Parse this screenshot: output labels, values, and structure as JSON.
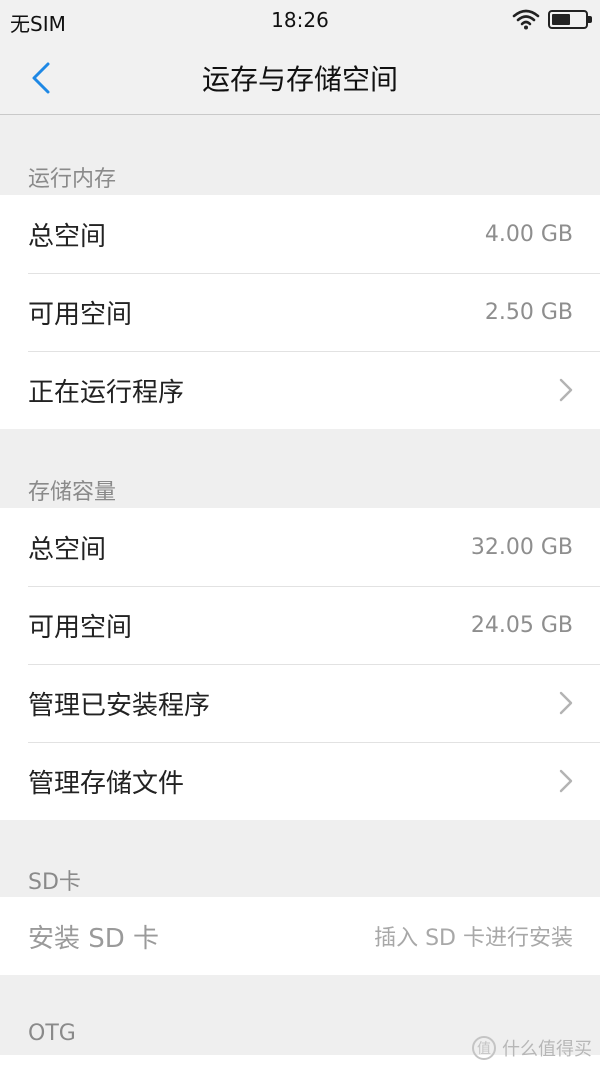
{
  "status_bar": {
    "carrier": "无SIM",
    "time": "18:26",
    "battery_level": 0.55
  },
  "nav": {
    "title": "运存与存储空间"
  },
  "sections": {
    "ram": {
      "header": "运行内存",
      "total_label": "总空间",
      "total_value": "4.00 GB",
      "available_label": "可用空间",
      "available_value": "2.50 GB",
      "running_label": "正在运行程序"
    },
    "storage": {
      "header": "存储容量",
      "total_label": "总空间",
      "total_value": "32.00 GB",
      "available_label": "可用空间",
      "available_value": "24.05 GB",
      "installed_label": "管理已安装程序",
      "files_label": "管理存储文件"
    },
    "sd": {
      "header": "SD卡",
      "install_label": "安装 SD 卡",
      "install_hint": "插入 SD 卡进行安装"
    },
    "otg": {
      "header": "OTG"
    }
  },
  "watermark": {
    "logo_glyph": "值",
    "text": "什么值得买"
  },
  "colors": {
    "accent": "#1e88e5",
    "background": "#efefef",
    "row_background": "#ffffff",
    "section_header": "#8a8a8a"
  }
}
